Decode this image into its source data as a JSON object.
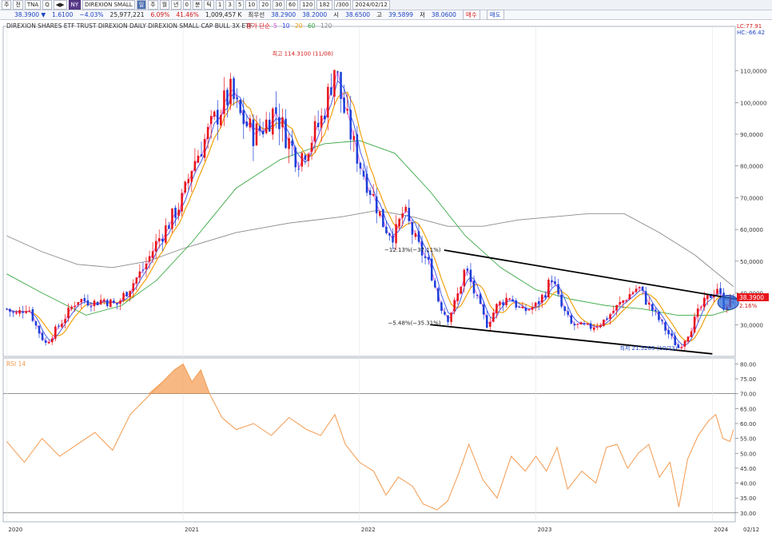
{
  "toolbar": {
    "items": [
      "주",
      "전",
      "TNA",
      "Q",
      "◀▶",
      "NY",
      "DIREXION SMALL",
      "일",
      "주",
      "월",
      "년",
      "0",
      "분",
      "틱",
      "1",
      "3",
      "5",
      "10",
      "20",
      "30",
      "60",
      "120",
      "182",
      "/300",
      "2024/02/12"
    ]
  },
  "quote": {
    "price": "38.3900 ▼",
    "change": "1.6100",
    "change_pct": "−4.03%",
    "volume": "25,977,221",
    "vol_ratio1": "6.09%",
    "vol_ratio2": "41.46%",
    "amount": "1,009,457 K",
    "priority_label": "최우선",
    "bid1": "38.2900",
    "bid2": "38.2000",
    "open_label": "시",
    "open": "38.6500",
    "high_label": "고",
    "high": "39.5899",
    "low_label": "저",
    "low": "38.0600",
    "buy_label": "매수",
    "sell_label": "매도"
  },
  "colors": {
    "up": "#e8151b",
    "down": "#1b3fd9",
    "ma5": "#e34fe0",
    "ma10": "#3a4ee6",
    "ma20": "#f2a10c",
    "ma60": "#3aa844",
    "ma120": "#8a8a8a",
    "rsi": "#f39a4f",
    "trendline": "#000000"
  },
  "chart_data": [
    {
      "type": "candlestick",
      "title": "DIREXION SHARES ETF TRUST DIREXION DAILY  DIREXION SMALL CAP BULL 3X ETF",
      "legend": [
        {
          "name": "종가 단순",
          "color": "#e8151b"
        },
        {
          "name": "5",
          "color": "#e34fe0"
        },
        {
          "name": "10",
          "color": "#3a4ee6"
        },
        {
          "name": "20",
          "color": "#f2a10c"
        },
        {
          "name": "60",
          "color": "#3aa844"
        },
        {
          "name": "120",
          "color": "#8a8a8a"
        }
      ],
      "corner_labels": [
        "LC:77.91",
        "HC:-66.42"
      ],
      "current_price_label": "38.3900",
      "current_pct_label": "2.16%",
      "y_ticks": [
        "110,0000",
        "100,0000",
        "90,0000",
        "80,0000",
        "70,0000",
        "60,0000",
        "50,0000",
        "40,0000",
        "30,0000"
      ],
      "y_tick_values": [
        110,
        100,
        90,
        80,
        70,
        60,
        50,
        40,
        30
      ],
      "ylim": [
        20,
        124
      ],
      "x_ticks": [
        "2020",
        "2021",
        "2022",
        "2023",
        "2024",
        "02/12"
      ],
      "annotations": [
        {
          "label": "최고 114.3100 (11/08)",
          "x": 2021.86,
          "y": 114.31
        },
        {
          "label": "−12.13%(−37.11%)",
          "x": 2022.47,
          "y": 53.5
        },
        {
          "label": "−5.48%(−35.31%)",
          "x": 2022.47,
          "y": 30.5
        },
        {
          "label": "최저 21.5205 (10/23)",
          "x": 2023.81,
          "y": 21.52
        }
      ],
      "trendlines": [
        {
          "from": [
            2022.48,
            53.5
          ],
          "to": [
            2024.14,
            38.0
          ]
        },
        {
          "from": [
            2022.4,
            30.0
          ],
          "to": [
            2024.0,
            20.8
          ]
        }
      ],
      "anchor_points": [
        [
          2020.0,
          35
        ],
        [
          2020.05,
          33
        ],
        [
          2020.12,
          36
        ],
        [
          2020.17,
          29
        ],
        [
          2020.22,
          24
        ],
        [
          2020.3,
          30
        ],
        [
          2020.4,
          38
        ],
        [
          2020.5,
          37
        ],
        [
          2020.55,
          38
        ],
        [
          2020.62,
          36
        ],
        [
          2020.7,
          42
        ],
        [
          2020.78,
          48
        ],
        [
          2020.85,
          56
        ],
        [
          2020.92,
          62
        ],
        [
          2021.0,
          70
        ],
        [
          2021.05,
          80
        ],
        [
          2021.12,
          88
        ],
        [
          2021.2,
          97
        ],
        [
          2021.27,
          103
        ],
        [
          2021.32,
          96
        ],
        [
          2021.4,
          90
        ],
        [
          2021.45,
          92
        ],
        [
          2021.52,
          98
        ],
        [
          2021.58,
          90
        ],
        [
          2021.65,
          82
        ],
        [
          2021.7,
          86
        ],
        [
          2021.78,
          94
        ],
        [
          2021.83,
          104
        ],
        [
          2021.86,
          112
        ],
        [
          2021.9,
          100
        ],
        [
          2021.97,
          86
        ],
        [
          2022.02,
          78
        ],
        [
          2022.08,
          70
        ],
        [
          2022.14,
          61
        ],
        [
          2022.2,
          58
        ],
        [
          2022.25,
          66
        ],
        [
          2022.32,
          56
        ],
        [
          2022.4,
          48
        ],
        [
          2022.45,
          37
        ],
        [
          2022.5,
          32
        ],
        [
          2022.55,
          38
        ],
        [
          2022.6,
          48
        ],
        [
          2022.65,
          40
        ],
        [
          2022.72,
          30
        ],
        [
          2022.78,
          36
        ],
        [
          2022.85,
          39
        ],
        [
          2022.92,
          34
        ],
        [
          2023.0,
          36
        ],
        [
          2023.05,
          40
        ],
        [
          2023.09,
          45
        ],
        [
          2023.14,
          36
        ],
        [
          2023.2,
          30
        ],
        [
          2023.3,
          29
        ],
        [
          2023.38,
          31
        ],
        [
          2023.45,
          35
        ],
        [
          2023.52,
          39
        ],
        [
          2023.58,
          42
        ],
        [
          2023.63,
          37
        ],
        [
          2023.68,
          33
        ],
        [
          2023.74,
          28
        ],
        [
          2023.81,
          22.5
        ],
        [
          2023.87,
          28
        ],
        [
          2023.93,
          35
        ],
        [
          2024.0,
          40
        ],
        [
          2024.03,
          42
        ],
        [
          2024.06,
          36
        ],
        [
          2024.09,
          37
        ],
        [
          2024.12,
          38.39
        ]
      ],
      "moving_averages": {
        "ma60": [
          [
            2020.0,
            46
          ],
          [
            2020.2,
            40
          ],
          [
            2020.45,
            33
          ],
          [
            2020.65,
            36
          ],
          [
            2020.85,
            44
          ],
          [
            2021.05,
            56
          ],
          [
            2021.3,
            73
          ],
          [
            2021.55,
            82
          ],
          [
            2021.8,
            87
          ],
          [
            2022.0,
            88
          ],
          [
            2022.2,
            84
          ],
          [
            2022.4,
            72
          ],
          [
            2022.6,
            58
          ],
          [
            2022.8,
            48
          ],
          [
            2023.0,
            41
          ],
          [
            2023.2,
            38
          ],
          [
            2023.4,
            36
          ],
          [
            2023.6,
            35
          ],
          [
            2023.8,
            33
          ],
          [
            2024.0,
            33
          ],
          [
            2024.12,
            35
          ]
        ],
        "ma120": [
          [
            2020.0,
            58
          ],
          [
            2020.2,
            53
          ],
          [
            2020.4,
            49
          ],
          [
            2020.6,
            48
          ],
          [
            2020.8,
            50
          ],
          [
            2021.0,
            54
          ],
          [
            2021.3,
            59
          ],
          [
            2021.6,
            62
          ],
          [
            2021.9,
            64
          ],
          [
            2022.1,
            66
          ],
          [
            2022.3,
            64
          ],
          [
            2022.5,
            61
          ],
          [
            2022.7,
            61
          ],
          [
            2022.9,
            63
          ],
          [
            2023.1,
            64
          ],
          [
            2023.3,
            65
          ],
          [
            2023.5,
            65
          ],
          [
            2023.7,
            59
          ],
          [
            2023.9,
            52
          ],
          [
            2024.12,
            42
          ]
        ]
      }
    },
    {
      "type": "line",
      "title": "RSI 14",
      "y_ticks": [
        "80.00",
        "75.00",
        "70.00",
        "65.00",
        "60.00",
        "55.00",
        "50.00",
        "45.00",
        "40.00",
        "35.00",
        "30.00"
      ],
      "y_tick_values": [
        80,
        75,
        70,
        65,
        60,
        55,
        50,
        45,
        40,
        35,
        30
      ],
      "ylim": [
        27,
        82
      ],
      "guide_levels": [
        70,
        30
      ],
      "x": [
        2020.0,
        2020.1,
        2020.2,
        2020.3,
        2020.4,
        2020.5,
        2020.6,
        2020.7,
        2020.8,
        2020.9,
        2020.95,
        2021.0,
        2021.05,
        2021.1,
        2021.15,
        2021.22,
        2021.3,
        2021.4,
        2021.5,
        2021.6,
        2021.7,
        2021.78,
        2021.86,
        2021.92,
        2022.0,
        2022.08,
        2022.15,
        2022.22,
        2022.3,
        2022.36,
        2022.44,
        2022.5,
        2022.56,
        2022.62,
        2022.7,
        2022.78,
        2022.86,
        2022.94,
        2023.0,
        2023.06,
        2023.12,
        2023.18,
        2023.26,
        2023.34,
        2023.4,
        2023.46,
        2023.52,
        2023.58,
        2023.64,
        2023.7,
        2023.76,
        2023.81,
        2023.86,
        2023.92,
        2023.98,
        2024.02,
        2024.06,
        2024.1,
        2024.12
      ],
      "values": [
        54,
        47,
        55,
        49,
        53,
        57,
        51,
        63,
        69,
        75,
        78,
        80,
        74,
        78,
        70,
        62,
        58,
        60,
        56,
        62,
        58,
        56,
        63,
        53,
        47,
        44,
        36,
        42,
        39,
        33,
        31,
        34,
        43,
        53,
        41,
        35,
        49,
        44,
        49,
        44,
        52,
        38,
        44,
        40,
        52,
        53,
        45,
        50,
        53,
        42,
        47,
        32,
        48,
        56,
        61,
        63,
        55,
        54,
        58
      ]
    }
  ]
}
